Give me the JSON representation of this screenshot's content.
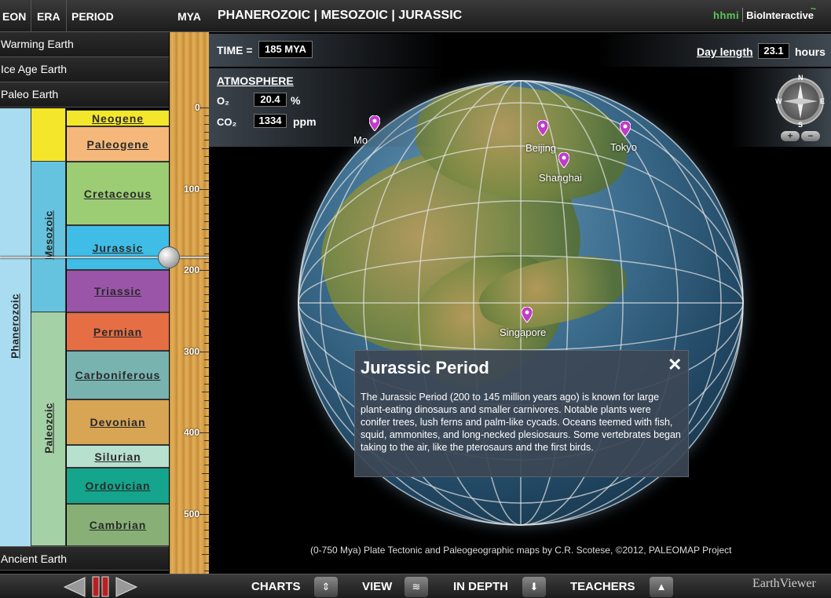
{
  "header": {
    "col_eon": "EON",
    "col_era": "ERA",
    "col_period": "PERIOD",
    "col_mya": "MYA",
    "breadcrumb": "PHANEROZOIC | MESOZOIC | JURASSIC",
    "logo_hhmi": "hhmi",
    "logo_bio": "BioInteractive"
  },
  "nav": {
    "warming": "Warming Earth",
    "iceage": "Ice Age Earth",
    "paleo": "Paleo Earth",
    "ancient": "Ancient Earth"
  },
  "timeline": {
    "eon": "Phanerozoic",
    "era_mesozoic": "Mesozoic",
    "era_paleozoic": "Paleozoic",
    "periods": [
      "Neogene",
      "Paleogene",
      "Cretaceous",
      "Jurassic",
      "Triassic",
      "Permian",
      "Carboniferous",
      "Devonian",
      "Silurian",
      "Ordovician",
      "Cambrian"
    ],
    "ticks": [
      "0",
      "100",
      "200",
      "300",
      "400",
      "500"
    ],
    "selected_mya": 185
  },
  "time": {
    "label": "TIME =",
    "value": "185 MYA"
  },
  "day": {
    "label": "Day length",
    "value": "23.1",
    "unit": "hours"
  },
  "atmosphere": {
    "label": "ATMOSPHERE",
    "o2_label": "O₂",
    "o2_value": "20.4",
    "o2_unit": "%",
    "co2_label": "CO₂",
    "co2_value": "1334",
    "co2_unit": "ppm"
  },
  "compass": {
    "n": "N",
    "s": "S",
    "e": "E",
    "w": "W"
  },
  "cities": {
    "moscow": "Mo",
    "beijing": "Beijing",
    "tokyo": "Tokyo",
    "shanghai": "Shanghai",
    "singapore": "Singapore"
  },
  "info": {
    "title": "Jurassic Period",
    "close": "✕",
    "text": "The Jurassic Period (200 to 145 million years ago) is known for large plant-eating dinosaurs and smaller carnivores. Notable plants were conifer trees, lush ferns and palm-like cycads. Oceans teemed with fish, squid, ammonites, and long-necked plesiosaurs. Some vertebrates began taking to the air, like the pterosaurs and the first birds."
  },
  "credit": "(0-750 Mya) Plate Tectonic and Paleogeographic maps by C.R. Scotese, ©2012, PALEOMAP Project",
  "bottom": {
    "charts": "CHARTS",
    "view": "VIEW",
    "indepth": "IN DEPTH",
    "teachers": "TEACHERS",
    "brand": "EarthViewer"
  },
  "colors": {
    "neogene": "#f4e62a",
    "paleogene": "#f5b87a",
    "cretaceous": "#9ccc74",
    "jurassic": "#3fbde6",
    "triassic": "#9a55a8",
    "permian": "#e56e44",
    "carboniferous": "#78b3b0",
    "devonian": "#d8a555",
    "silurian": "#b8e0cf",
    "ordovician": "#14a58c",
    "cambrian": "#88b076",
    "eon": "#a9dcf0",
    "mesozoic": "#65c3df",
    "paleozoic": "#a4d1a6",
    "cenozoic": "#f4e62a",
    "pin": "#c03bc7"
  }
}
